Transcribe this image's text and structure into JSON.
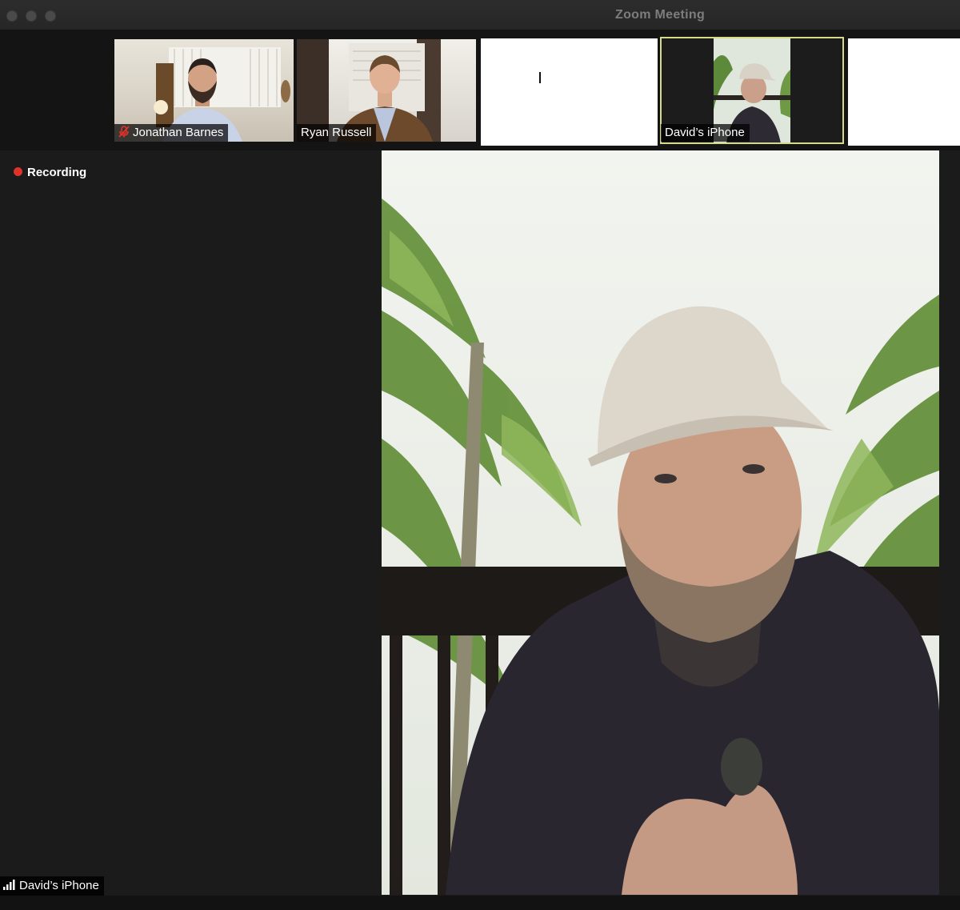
{
  "window": {
    "title": "Zoom Meeting"
  },
  "participants": [
    {
      "name": "Jonathan Barnes",
      "muted": true
    },
    {
      "name": "Ryan Russell",
      "muted": false
    },
    {
      "name": "",
      "muted": false
    },
    {
      "name": "David’s iPhone",
      "muted": false,
      "active_speaker": true
    },
    {
      "name": "",
      "muted": false
    }
  ],
  "status": {
    "recording_label": "Recording"
  },
  "main_view": {
    "speaker_name": "David’s iPhone"
  },
  "colors": {
    "recording_dot": "#e0322a",
    "active_speaker_border": "#d7d98a",
    "mute_icon": "#e0322a"
  }
}
